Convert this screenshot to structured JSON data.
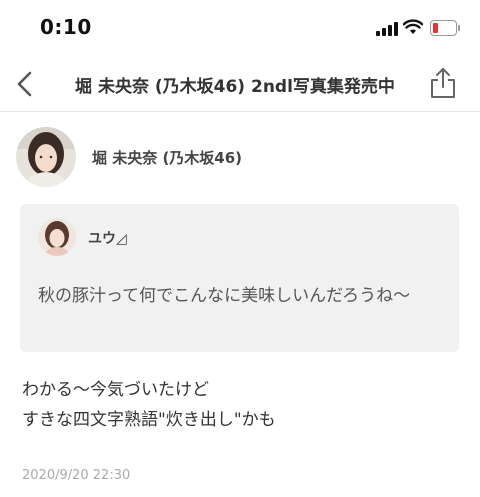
{
  "status_bar": {
    "time": "0:10",
    "battery_color": "#e5333a"
  },
  "nav": {
    "title": "堀 未央奈 (乃木坂46) 2ndl写真集発売中",
    "back_icon": "chevron-left-icon",
    "share_icon": "share-icon"
  },
  "author": {
    "name": "堀 未央奈 (乃木坂46)"
  },
  "quote": {
    "user_name": "ユウ◿",
    "text": "秋の豚汁って何でこんなに美味しいんだろうね〜"
  },
  "post": {
    "lines": [
      "わかる〜今気づいたけど",
      "すきな四文字熟語\"炊き出し\"かも"
    ],
    "timestamp": "2020/9/20 22:30"
  }
}
